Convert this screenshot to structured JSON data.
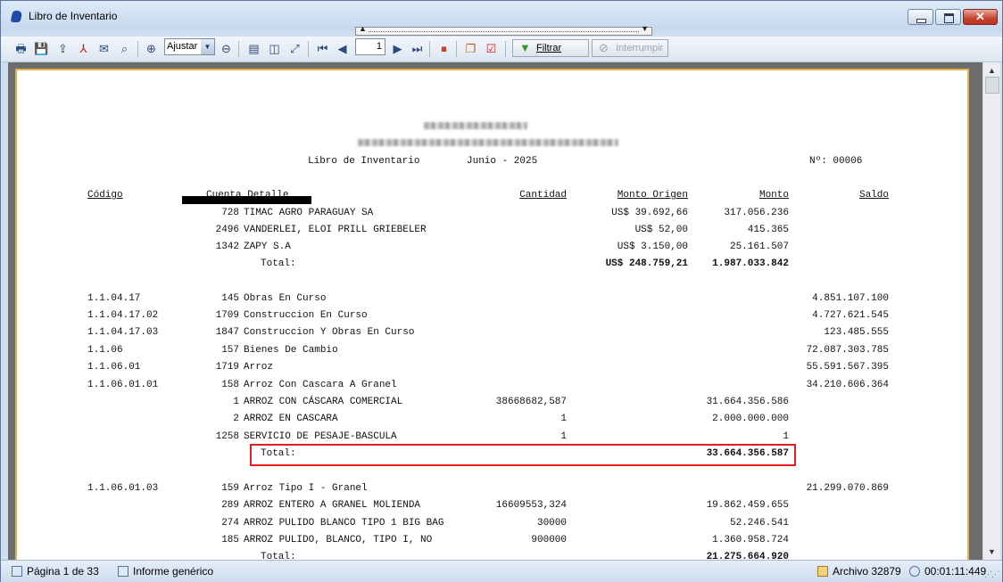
{
  "window": {
    "title": "Libro de Inventario"
  },
  "toolbar": {
    "zoom_value": "Ajustar a",
    "page_value": "1",
    "filter_label": "Filtrar",
    "interrupt_label": "Interrumpir"
  },
  "report": {
    "title": "Libro de Inventario",
    "period": "Junio - 2025",
    "number": "Nº: 00006",
    "headers": {
      "codigo": "Código",
      "cuenta_detalle": "Cuenta Detalle",
      "cantidad": "Cantidad",
      "monto_origen": "Monto Origen",
      "monto": "Monto",
      "saldo": "Saldo"
    },
    "rows": [
      {
        "codigo": "",
        "cuenta": "728",
        "detalle": "TIMAC AGRO PARAGUAY SA",
        "cantidad": "",
        "monto_origen": "US$ 39.692,66",
        "monto": "317.056.236",
        "saldo": ""
      },
      {
        "codigo": "",
        "cuenta": "2496",
        "detalle": "VANDERLEI, ELOI PRILL GRIEBELER",
        "cantidad": "",
        "monto_origen": "US$ 52,00",
        "monto": "415.365",
        "saldo": ""
      },
      {
        "codigo": "",
        "cuenta": "1342",
        "detalle": "ZAPY S.A",
        "cantidad": "",
        "monto_origen": "US$ 3.150,00",
        "monto": "25.161.507",
        "saldo": ""
      },
      {
        "codigo": "",
        "cuenta": "",
        "detalle": "Total:",
        "cantidad": "",
        "monto_origen": "US$ 248.759,21",
        "monto": "1.987.033.842",
        "saldo": "",
        "total": true
      },
      {
        "codigo": "1.1.04.17",
        "cuenta": "145",
        "detalle": "Obras En Curso",
        "cantidad": "",
        "monto_origen": "",
        "monto": "",
        "saldo": "4.851.107.100"
      },
      {
        "codigo": "1.1.04.17.02",
        "cuenta": "1709",
        "detalle": "Construccion En Curso",
        "cantidad": "",
        "monto_origen": "",
        "monto": "",
        "saldo": "4.727.621.545"
      },
      {
        "codigo": "1.1.04.17.03",
        "cuenta": "1847",
        "detalle": "Construccion Y Obras En Curso",
        "cantidad": "",
        "monto_origen": "",
        "monto": "",
        "saldo": "123.485.555"
      },
      {
        "codigo": "1.1.06",
        "cuenta": "157",
        "detalle": "Bienes De Cambio",
        "cantidad": "",
        "monto_origen": "",
        "monto": "",
        "saldo": "72.087.303.785"
      },
      {
        "codigo": "1.1.06.01",
        "cuenta": "1719",
        "detalle": "Arroz",
        "cantidad": "",
        "monto_origen": "",
        "monto": "",
        "saldo": "55.591.567.395"
      },
      {
        "codigo": "1.1.06.01.01",
        "cuenta": "158",
        "detalle": "Arroz Con Cascara A Granel",
        "cantidad": "",
        "monto_origen": "",
        "monto": "",
        "saldo": "34.210.606.364"
      },
      {
        "codigo": "",
        "cuenta": "1",
        "detalle": "ARROZ CON CÁSCARA COMERCIAL",
        "cantidad": "38668682,587",
        "monto_origen": "",
        "monto": "31.664.356.586",
        "saldo": ""
      },
      {
        "codigo": "",
        "cuenta": "2",
        "detalle": "ARROZ EN CASCARA",
        "cantidad": "1",
        "monto_origen": "",
        "monto": "2.000.000.000",
        "saldo": ""
      },
      {
        "codigo": "",
        "cuenta": "1258",
        "detalle": "SERVICIO DE PESAJE-BASCULA",
        "cantidad": "1",
        "monto_origen": "",
        "monto": "1",
        "saldo": ""
      },
      {
        "codigo": "",
        "cuenta": "",
        "detalle": "Total:",
        "cantidad": "",
        "monto_origen": "",
        "monto": "33.664.356.587",
        "saldo": "",
        "total": true
      },
      {
        "codigo": "1.1.06.01.03",
        "cuenta": "159",
        "detalle": "Arroz Tipo I - Granel",
        "cantidad": "",
        "monto_origen": "",
        "monto": "",
        "saldo": "21.299.070.869"
      },
      {
        "codigo": "",
        "cuenta": "289",
        "detalle": "ARROZ ENTERO A GRANEL MOLIENDA",
        "cantidad": "16609553,324",
        "monto_origen": "",
        "monto": "19.862.459.655",
        "saldo": ""
      },
      {
        "codigo": "",
        "cuenta": "274",
        "detalle": "ARROZ PULIDO BLANCO TIPO 1 BIG BAG",
        "cantidad": "30000",
        "monto_origen": "",
        "monto": "52.246.541",
        "saldo": ""
      },
      {
        "codigo": "",
        "cuenta": "185",
        "detalle": "ARROZ PULIDO, BLANCO, TIPO I, NO",
        "cantidad": "900000",
        "monto_origen": "",
        "monto": "1.360.958.724",
        "saldo": ""
      },
      {
        "codigo": "",
        "cuenta": "",
        "detalle": "Total:",
        "cantidad": "",
        "monto_origen": "",
        "monto": "21.275.664.920",
        "saldo": "",
        "total": true
      }
    ]
  },
  "statusbar": {
    "page_info": "Página 1 de 33",
    "report_type": "Informe genérico",
    "file_info": "Archivo 32879",
    "elapsed": "00:01:11:449"
  },
  "colors": {
    "highlight": "#e02020",
    "page_border": "#e3b34c"
  }
}
